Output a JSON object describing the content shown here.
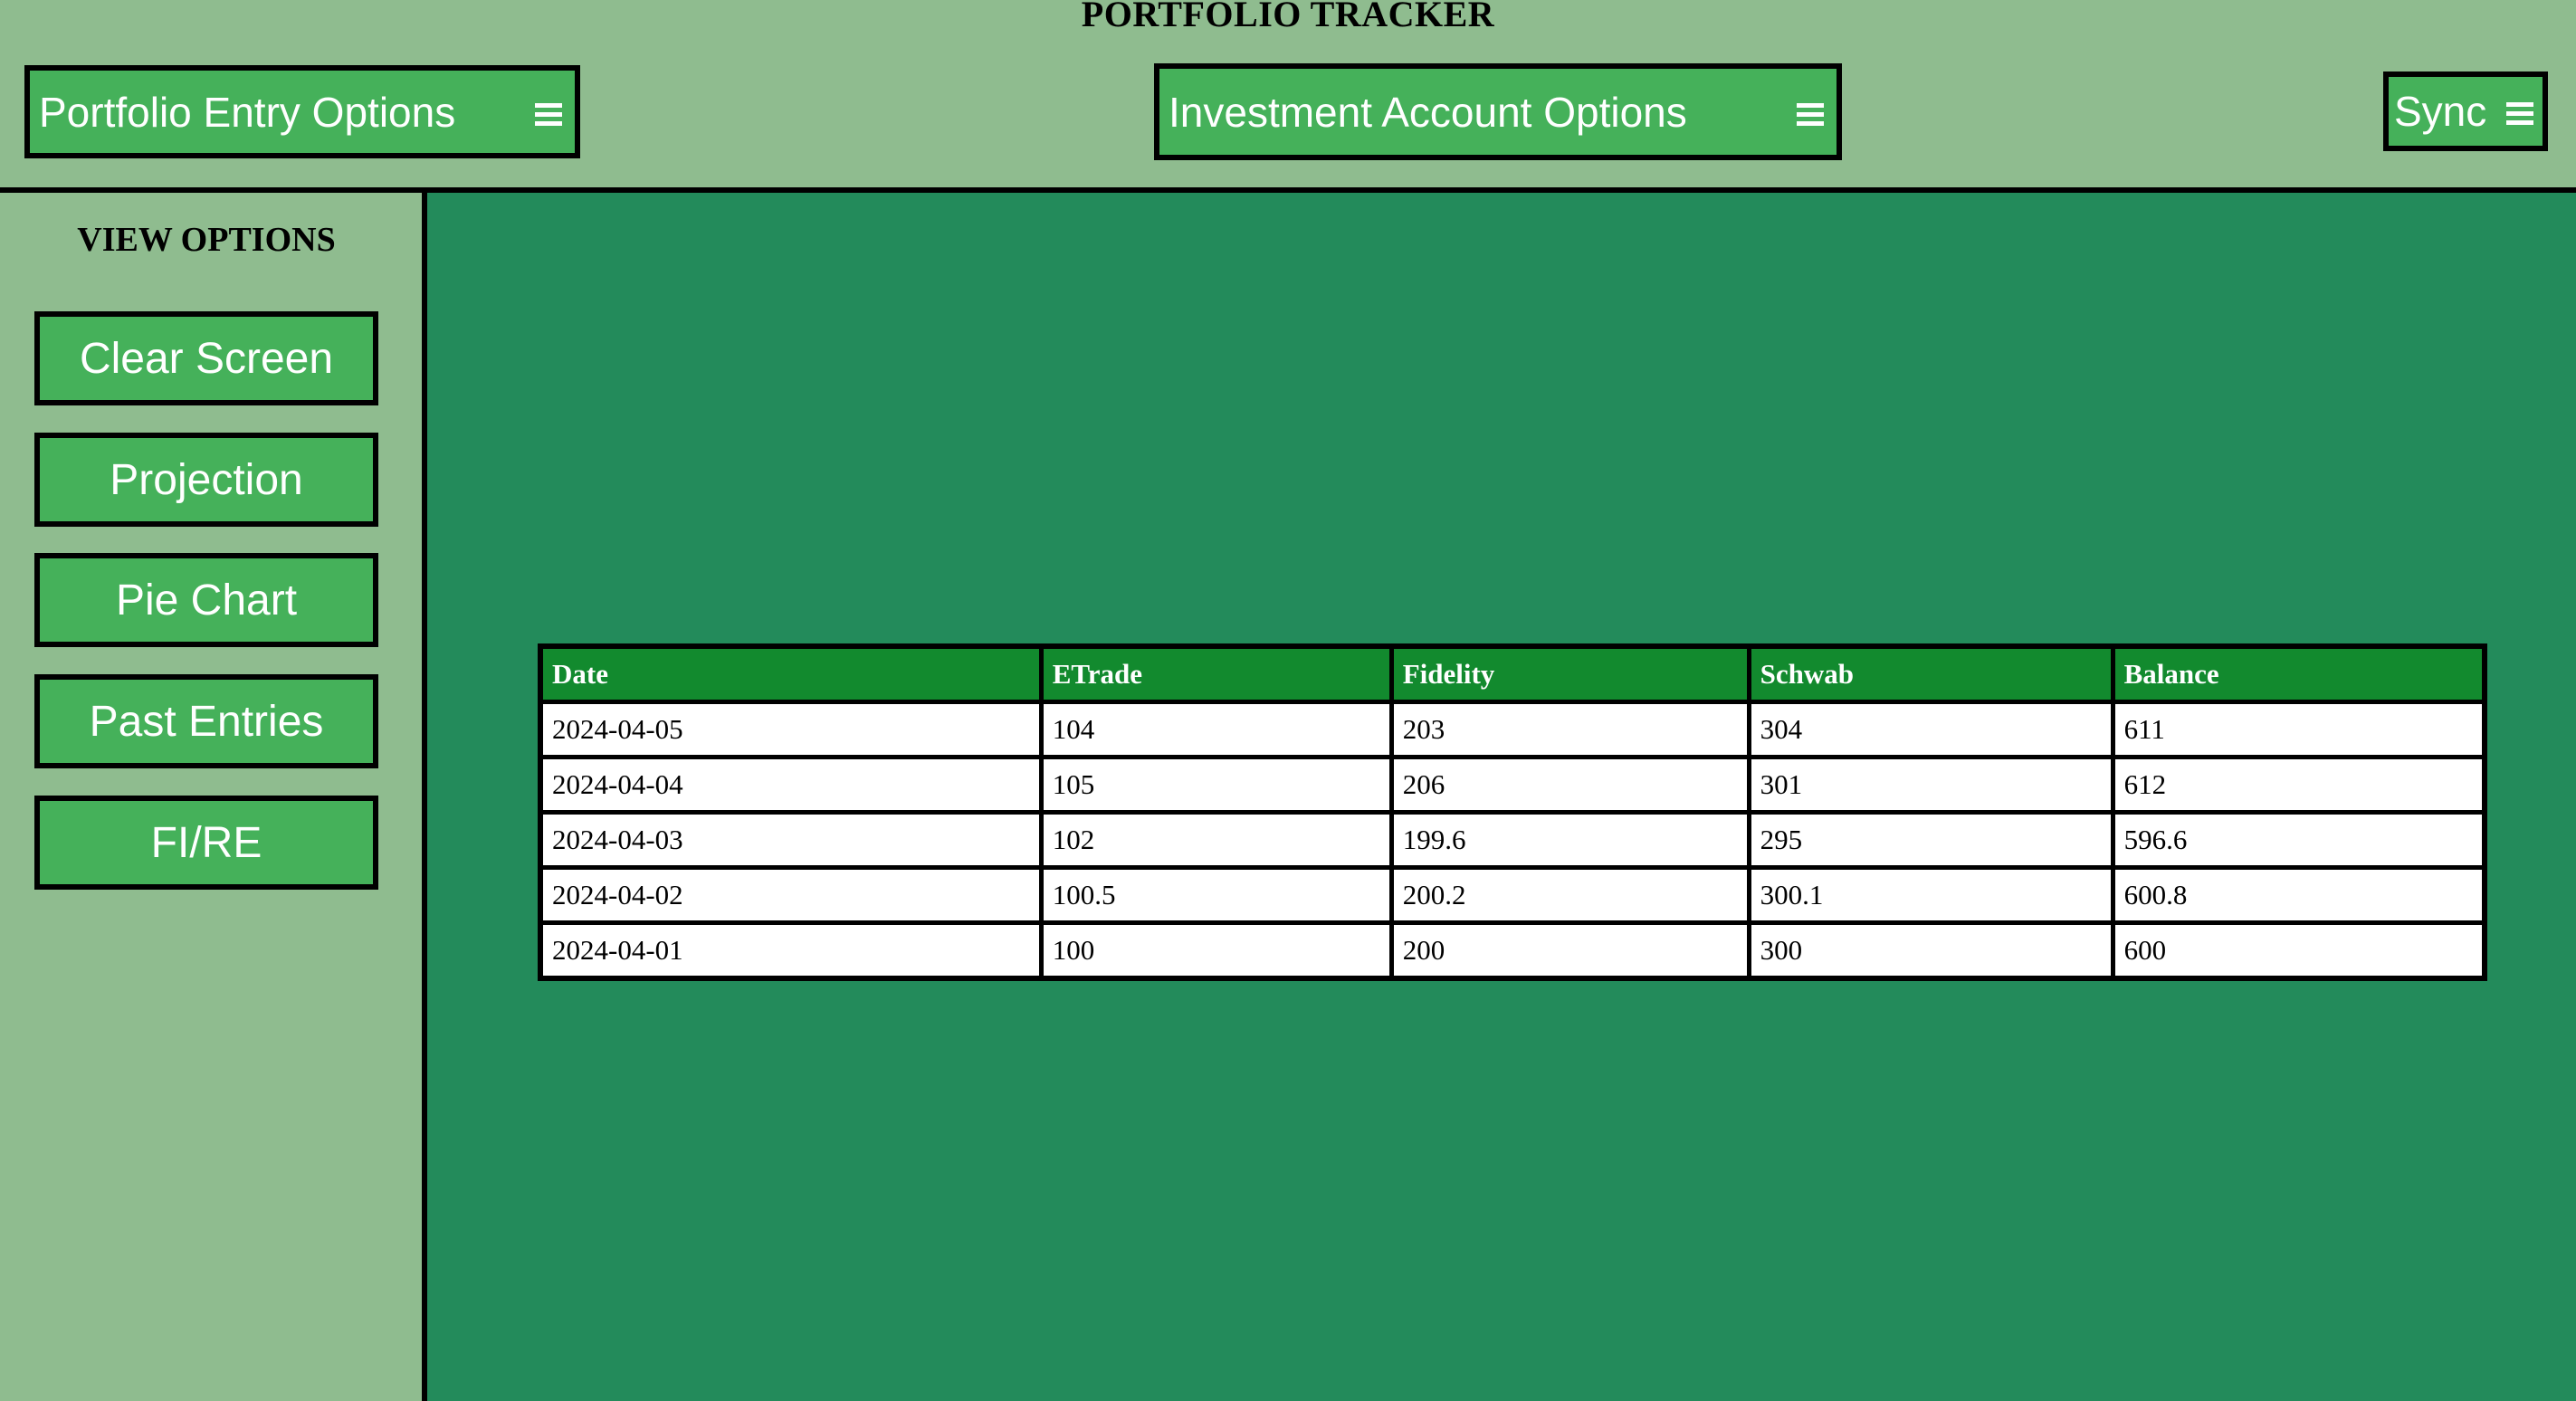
{
  "app": {
    "title": "PORTFOLIO TRACKER"
  },
  "header": {
    "portfolio_entry_label": "Portfolio Entry Options",
    "investment_account_label": "Investment Account Options",
    "sync_label": "Sync",
    "menu_icon": "hamburger-menu-icon"
  },
  "sidebar": {
    "heading": "VIEW OPTIONS",
    "buttons": [
      {
        "label": "Clear Screen"
      },
      {
        "label": "Projection"
      },
      {
        "label": "Pie Chart"
      },
      {
        "label": "Past Entries"
      },
      {
        "label": "FI/RE"
      }
    ]
  },
  "table": {
    "headers": [
      "Date",
      "ETrade",
      "Fidelity",
      "Schwab",
      "Balance"
    ],
    "rows": [
      [
        "2024-04-05",
        "104",
        "203",
        "304",
        "611"
      ],
      [
        "2024-04-04",
        "105",
        "206",
        "301",
        "612"
      ],
      [
        "2024-04-03",
        "102",
        "199.6",
        "295",
        "596.6"
      ],
      [
        "2024-04-02",
        "100.5",
        "200.2",
        "300.1",
        "600.8"
      ],
      [
        "2024-04-01",
        "100",
        "200",
        "300",
        "600"
      ]
    ]
  },
  "colors": {
    "background": "#8fbc8f",
    "button": "#45b15a",
    "main_panel": "#238b5b",
    "table_header": "#128a2e"
  }
}
